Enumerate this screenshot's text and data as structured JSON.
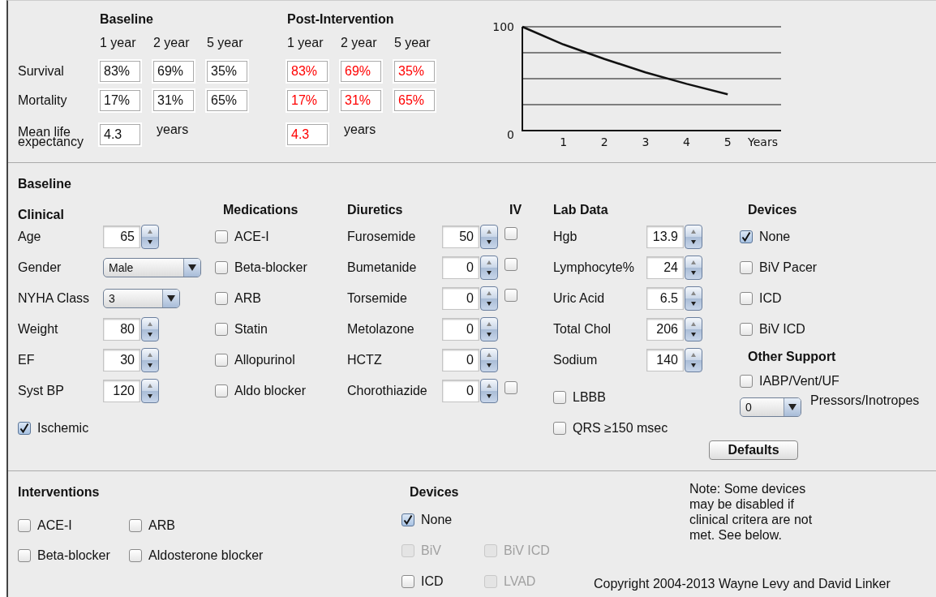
{
  "results": {
    "baseline_heading": "Baseline",
    "post_heading": "Post-Intervention",
    "baseline_years": [
      "1 year",
      "2 year",
      "5 year"
    ],
    "post_years": [
      "1 year",
      "2 year",
      "5 year"
    ],
    "rows": [
      {
        "label": "Survival",
        "baseline": [
          "83%",
          "69%",
          "35%"
        ],
        "post": [
          "83%",
          "69%",
          "35%"
        ]
      },
      {
        "label": "Mortality",
        "baseline": [
          "17%",
          "31%",
          "65%"
        ],
        "post": [
          "17%",
          "31%",
          "65%"
        ]
      }
    ],
    "life_expectancy": {
      "label": "Mean life expectancy",
      "baseline": "4.3",
      "baseline_unit": "years",
      "post": "4.3",
      "post_unit": "years"
    }
  },
  "chart": {
    "chart_data": {
      "type": "line",
      "xlabel": "Years",
      "x": [
        0,
        1,
        2,
        3,
        4,
        5
      ],
      "values": [
        100,
        83,
        69,
        56,
        45,
        35
      ],
      "xlim": [
        0,
        6.3
      ],
      "ylim": [
        0,
        100
      ],
      "xticks": [
        1,
        2,
        3,
        4,
        5
      ],
      "yticks": [
        0,
        100
      ]
    }
  },
  "baseline": {
    "title": "Baseline",
    "clinical": {
      "title": "Clinical",
      "fields": [
        {
          "kind": "spinner",
          "label": "Age",
          "value": "65"
        },
        {
          "kind": "dropdown",
          "label": "Gender",
          "value": "Male"
        },
        {
          "kind": "dropdown",
          "label": "NYHA Class",
          "value": "3"
        },
        {
          "kind": "spinner",
          "label": "Weight",
          "value": "80"
        },
        {
          "kind": "spinner",
          "label": "EF",
          "value": "30"
        },
        {
          "kind": "spinner",
          "label": "Syst BP",
          "value": "120"
        }
      ],
      "ischemic": {
        "label": "Ischemic",
        "checked": true
      }
    },
    "medications": {
      "title": "Medications",
      "items": [
        {
          "label": "ACE-I",
          "checked": false
        },
        {
          "label": "Beta-blocker",
          "checked": false
        },
        {
          "label": "ARB",
          "checked": false
        },
        {
          "label": "Statin",
          "checked": false
        },
        {
          "label": "Allopurinol",
          "checked": false
        },
        {
          "label": "Aldo blocker",
          "checked": false
        }
      ]
    },
    "diuretics": {
      "title": "Diuretics",
      "iv_heading": "IV",
      "items": [
        {
          "label": "Furosemide",
          "value": "50",
          "iv_checked": false
        },
        {
          "label": "Bumetanide",
          "value": "0",
          "iv_checked": false
        },
        {
          "label": "Torsemide",
          "value": "0",
          "iv_checked": false
        },
        {
          "label": "Metolazone",
          "value": "0"
        },
        {
          "label": "HCTZ",
          "value": "0"
        },
        {
          "label": "Chorothiazide",
          "value": "0",
          "iv_checked": false
        }
      ]
    },
    "lab_data": {
      "title": "Lab Data",
      "items": [
        {
          "label": "Hgb",
          "value": "13.9"
        },
        {
          "label": "Lymphocyte%",
          "value": "24"
        },
        {
          "label": "Uric Acid",
          "value": "6.5"
        },
        {
          "label": "Total Chol",
          "value": "206"
        },
        {
          "label": "Sodium",
          "value": "140"
        }
      ],
      "flags": [
        {
          "label": "LBBB",
          "checked": false
        },
        {
          "label": "QRS ≥150 msec",
          "checked": false
        }
      ]
    },
    "devices": {
      "title": "Devices",
      "items": [
        {
          "label": "None",
          "checked": true
        },
        {
          "label": "BiV Pacer",
          "checked": false
        },
        {
          "label": "ICD",
          "checked": false
        },
        {
          "label": "BiV ICD",
          "checked": false
        }
      ]
    },
    "other_support": {
      "title": "Other Support",
      "items": [
        {
          "label": "IABP/Vent/UF",
          "checked": false
        }
      ],
      "pressors": {
        "value": "0",
        "label": "Pressors/Inotropes"
      }
    },
    "defaults_button": "Defaults"
  },
  "interventions": {
    "title": "Interventions",
    "items": [
      {
        "label": "ACE-I",
        "checked": false
      },
      {
        "label": "ARB",
        "checked": false
      },
      {
        "label": "Beta-blocker",
        "checked": false
      },
      {
        "label": "Aldosterone blocker",
        "checked": false
      }
    ]
  },
  "intervention_devices": {
    "title": "Devices",
    "rows": [
      [
        {
          "label": "None",
          "checked": true,
          "disabled": false
        }
      ],
      [
        {
          "label": "BiV",
          "checked": false,
          "disabled": true
        },
        {
          "label": "BiV ICD",
          "checked": false,
          "disabled": true
        }
      ],
      [
        {
          "label": "ICD",
          "checked": false,
          "disabled": false
        },
        {
          "label": "LVAD",
          "checked": false,
          "disabled": true
        }
      ]
    ]
  },
  "note": "Note: Some devices may be disabled if clinical critera are not met. See below.",
  "copyright": "Copyright 2004-2013 Wayne Levy and David Linker"
}
